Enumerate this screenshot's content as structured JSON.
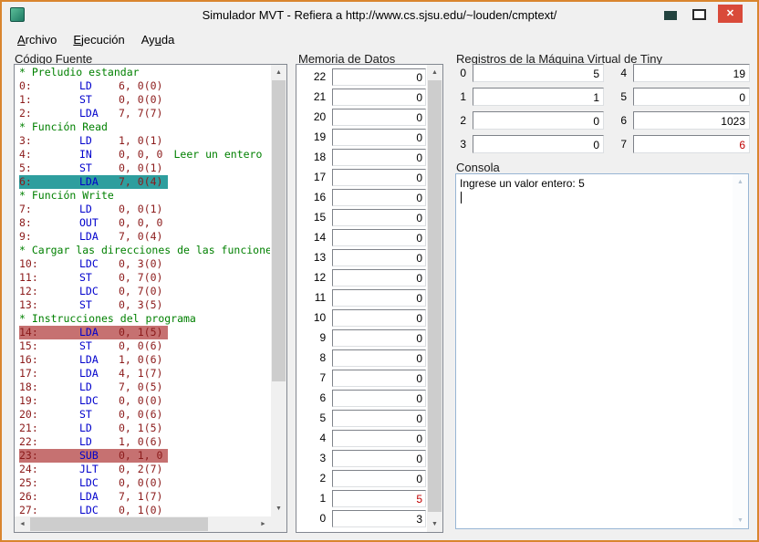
{
  "window": {
    "title": "Simulador MVT - Refiera a http://www.cs.sjsu.edu/~louden/cmptext/"
  },
  "icons": {
    "close": "✕",
    "scroll_up": "▲",
    "scroll_down": "▼",
    "scroll_left": "◄",
    "scroll_right": "►"
  },
  "colors": {
    "accent_border": "#d9852e",
    "close_button": "#d94a3a",
    "comment": "#008000",
    "opcode": "#0000cc",
    "operand": "#8b1a1a",
    "highlight_current": "#2e9e9e",
    "highlight_break": "#c67171",
    "value_red": "#c00000"
  },
  "menu": [
    {
      "key": "archivo",
      "pre": "",
      "accel": "A",
      "post": "rchivo"
    },
    {
      "key": "ejecucion",
      "pre": "",
      "accel": "E",
      "post": "jecución"
    },
    {
      "key": "ayuda",
      "pre": "Ay",
      "accel": "u",
      "post": "da"
    }
  ],
  "source": {
    "label": "Código Fuente",
    "lines": [
      {
        "type": "comment",
        "text": "* Preludio estandar"
      },
      {
        "type": "code",
        "addr": "0:",
        "op": "LD",
        "args": "6, 0(0)"
      },
      {
        "type": "code",
        "addr": "1:",
        "op": "ST",
        "args": "0, 0(0)"
      },
      {
        "type": "code",
        "addr": "2:",
        "op": "LDA",
        "args": "7, 7(7)"
      },
      {
        "type": "comment",
        "text": "* Función Read"
      },
      {
        "type": "code",
        "addr": "3:",
        "op": "LD",
        "args": "1, 0(1)"
      },
      {
        "type": "code",
        "addr": "4:",
        "op": "IN",
        "args": "0, 0, 0",
        "comment": "Leer un entero"
      },
      {
        "type": "code",
        "addr": "5:",
        "op": "ST",
        "args": "0, 0(1)"
      },
      {
        "type": "code",
        "addr": "6:",
        "op": "LDA",
        "args": "7, 0(4)",
        "highlight": "current"
      },
      {
        "type": "comment",
        "text": "* Función Write"
      },
      {
        "type": "code",
        "addr": "7:",
        "op": "LD",
        "args": "0, 0(1)"
      },
      {
        "type": "code",
        "addr": "8:",
        "op": "OUT",
        "args": "0, 0, 0"
      },
      {
        "type": "code",
        "addr": "9:",
        "op": "LDA",
        "args": "7, 0(4)"
      },
      {
        "type": "comment",
        "text": "* Cargar las direcciones de las funcione"
      },
      {
        "type": "code",
        "addr": "10:",
        "op": "LDC",
        "args": "0, 3(0)"
      },
      {
        "type": "code",
        "addr": "11:",
        "op": "ST",
        "args": "0, 7(0)"
      },
      {
        "type": "code",
        "addr": "12:",
        "op": "LDC",
        "args": "0, 7(0)"
      },
      {
        "type": "code",
        "addr": "13:",
        "op": "ST",
        "args": "0, 3(5)"
      },
      {
        "type": "comment",
        "text": "* Instrucciones del programa"
      },
      {
        "type": "code",
        "addr": "14:",
        "op": "LDA",
        "args": "0, 1(5)",
        "highlight": "break"
      },
      {
        "type": "code",
        "addr": "15:",
        "op": "ST",
        "args": "0, 0(6)"
      },
      {
        "type": "code",
        "addr": "16:",
        "op": "LDA",
        "args": "1, 0(6)"
      },
      {
        "type": "code",
        "addr": "17:",
        "op": "LDA",
        "args": "4, 1(7)"
      },
      {
        "type": "code",
        "addr": "18:",
        "op": "LD",
        "args": "7, 0(5)"
      },
      {
        "type": "code",
        "addr": "19:",
        "op": "LDC",
        "args": "0, 0(0)"
      },
      {
        "type": "code",
        "addr": "20:",
        "op": "ST",
        "args": "0, 0(6)"
      },
      {
        "type": "code",
        "addr": "21:",
        "op": "LD",
        "args": "0, 1(5)"
      },
      {
        "type": "code",
        "addr": "22:",
        "op": "LD",
        "args": "1, 0(6)"
      },
      {
        "type": "code",
        "addr": "23:",
        "op": "SUB",
        "args": "0, 1, 0",
        "highlight": "break"
      },
      {
        "type": "code",
        "addr": "24:",
        "op": "JLT",
        "args": "0, 2(7)"
      },
      {
        "type": "code",
        "addr": "25:",
        "op": "LDC",
        "args": "0, 0(0)"
      },
      {
        "type": "code",
        "addr": "26:",
        "op": "LDA",
        "args": "7, 1(7)"
      },
      {
        "type": "code",
        "addr": "27:",
        "op": "LDC",
        "args": "0, 1(0)"
      }
    ]
  },
  "memory": {
    "label": "Memoria de Datos",
    "rows": [
      {
        "addr": "22",
        "value": "0"
      },
      {
        "addr": "21",
        "value": "0"
      },
      {
        "addr": "20",
        "value": "0"
      },
      {
        "addr": "19",
        "value": "0"
      },
      {
        "addr": "18",
        "value": "0"
      },
      {
        "addr": "17",
        "value": "0"
      },
      {
        "addr": "16",
        "value": "0"
      },
      {
        "addr": "15",
        "value": "0"
      },
      {
        "addr": "14",
        "value": "0"
      },
      {
        "addr": "13",
        "value": "0"
      },
      {
        "addr": "12",
        "value": "0"
      },
      {
        "addr": "11",
        "value": "0"
      },
      {
        "addr": "10",
        "value": "0"
      },
      {
        "addr": "9",
        "value": "0"
      },
      {
        "addr": "8",
        "value": "0"
      },
      {
        "addr": "7",
        "value": "0"
      },
      {
        "addr": "6",
        "value": "0"
      },
      {
        "addr": "5",
        "value": "0"
      },
      {
        "addr": "4",
        "value": "0"
      },
      {
        "addr": "3",
        "value": "0"
      },
      {
        "addr": "2",
        "value": "0"
      },
      {
        "addr": "1",
        "value": "5",
        "red": true
      },
      {
        "addr": "0",
        "value": "3"
      }
    ]
  },
  "registers": {
    "label": "Registros de la Máquina Virtual de Tiny",
    "items": [
      {
        "num": "0",
        "value": "5"
      },
      {
        "num": "1",
        "value": "1"
      },
      {
        "num": "2",
        "value": "0"
      },
      {
        "num": "3",
        "value": "0"
      },
      {
        "num": "4",
        "value": "19"
      },
      {
        "num": "5",
        "value": "0"
      },
      {
        "num": "6",
        "value": "1023"
      },
      {
        "num": "7",
        "value": "6",
        "red": true
      }
    ]
  },
  "console": {
    "label": "Consola",
    "text": "Ingrese un valor entero: 5"
  }
}
